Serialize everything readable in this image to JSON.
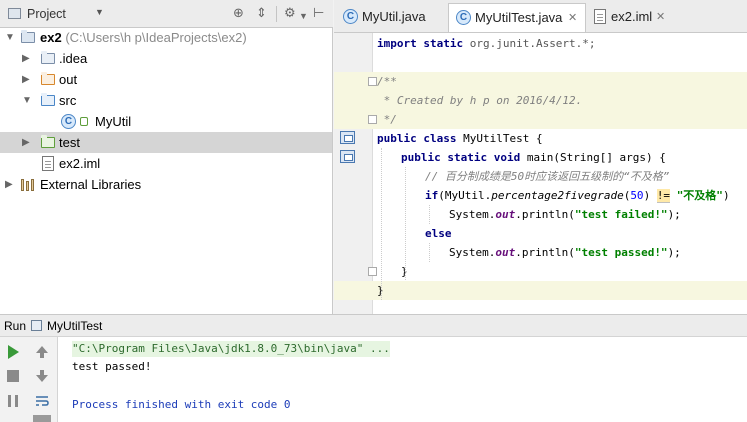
{
  "project": {
    "title": "Project",
    "tree": [
      {
        "label": "ex2",
        "path": "(C:\\Users\\h p\\IdeaProjects\\ex2)"
      },
      {
        "label": ".idea"
      },
      {
        "label": "out"
      },
      {
        "label": "src"
      },
      {
        "label": "MyUtil"
      },
      {
        "label": "test"
      },
      {
        "label": "ex2.iml"
      },
      {
        "label": "External Libraries"
      }
    ]
  },
  "editor": {
    "tabs": [
      {
        "label": "MyUtil.java"
      },
      {
        "label": "MyUtilTest.java"
      },
      {
        "label": "ex2.iml"
      }
    ],
    "code": {
      "import_line": "org.junit.Assert.*;",
      "doc_open": "/**",
      "doc_body": " * Created by h p on 2016/4/12.",
      "doc_close": " */",
      "class_name": "MyUtilTest {",
      "main_sig": "main(String[] args) {",
      "comment": "// 百分制成绩是50时应该返回五级制的“不及格”",
      "if_call": "(MyUtil.",
      "method": "percentage2fivegrade",
      "arg": "50",
      "ne": "!=",
      "string1": "\"不及格\"",
      "println1_pre": "System.",
      "out": "out",
      "println_call": ".println(",
      "str_failed": "\"test failed!\"",
      "str_passed": "\"test passed!\"",
      "close_paren": ");",
      "close_brace": "}",
      "else_kw": "else"
    }
  },
  "run": {
    "label": "Run",
    "config": "MyUtilTest",
    "console": [
      "\"C:\\Program Files\\Java\\jdk1.8.0_73\\bin\\java\" ...",
      "test passed!",
      "",
      "Process finished with exit code 0"
    ]
  },
  "colors": {
    "keyword": "#000080",
    "string": "#008000",
    "comment": "#808080",
    "number": "#0000ff",
    "selection": "#d5d5d5",
    "highlight_line": "#f7f7e0"
  }
}
